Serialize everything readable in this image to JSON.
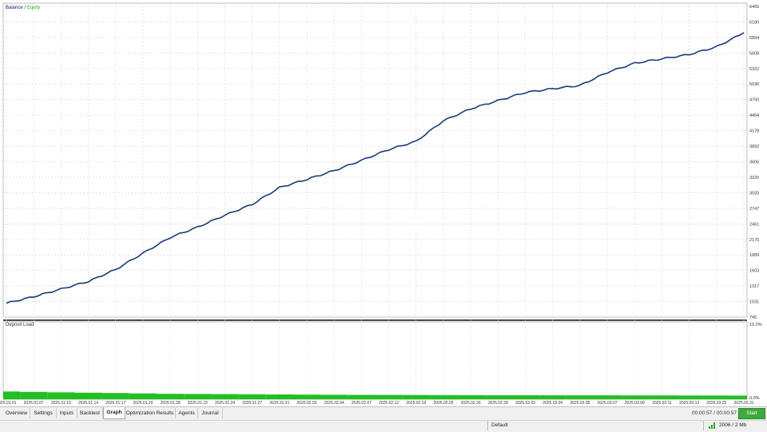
{
  "chart": {
    "legend_balance": "Balance",
    "legend_separator": " / ",
    "legend_equity": "Equity",
    "subchart_title": "Deposit Load",
    "line_color": "#1a3a7a",
    "load_color": "#21c021",
    "y_ticks": [
      "6466",
      "6180",
      "5894",
      "5608",
      "5322",
      "5036",
      "4750",
      "4464",
      "4178",
      "3892",
      "3606",
      "3320",
      "3033",
      "2747",
      "2461",
      "2175",
      "1889",
      "1603",
      "1317",
      "1031",
      "745"
    ],
    "load_ticks": [
      "10.0%",
      "0.0%"
    ],
    "x_ticks": [
      "2025.01.01",
      "2025.01.07",
      "2025.01.10",
      "2025.01.14",
      "2025.01.17",
      "2025.01.20",
      "2025.01.28",
      "2025.01.23",
      "2025.01.24",
      "2025.01.27",
      "2025.01.31",
      "2025.02.03",
      "2025.02.04",
      "2025.02.07",
      "2025.02.12",
      "2025.02.19",
      "2025.02.25",
      "2025.02.26",
      "2025.02.28",
      "2025.03.03",
      "2025.03.04",
      "2025.03.05",
      "2025.03.07",
      "2025.03.09",
      "2025.03.11",
      "2025.03.13",
      "2025.03.25",
      "2025.03.31"
    ]
  },
  "chart_data": {
    "type": "line",
    "title": "",
    "series": [
      {
        "name": "Balance",
        "x": [
          "2025.01.01",
          "2025.01.07",
          "2025.01.10",
          "2025.01.14",
          "2025.01.17",
          "2025.01.20",
          "2025.01.28",
          "2025.01.23",
          "2025.01.24",
          "2025.01.27",
          "2025.01.31",
          "2025.02.03",
          "2025.02.04",
          "2025.02.07",
          "2025.02.12",
          "2025.02.19",
          "2025.02.25",
          "2025.02.26",
          "2025.02.28",
          "2025.03.03",
          "2025.03.04",
          "2025.03.05",
          "2025.03.07",
          "2025.03.09",
          "2025.03.11",
          "2025.03.13",
          "2025.03.25",
          "2025.03.31"
        ],
        "values": [
          1000,
          1120,
          1260,
          1400,
          1620,
          1920,
          2210,
          2400,
          2620,
          2820,
          3130,
          3280,
          3440,
          3630,
          3830,
          3980,
          4360,
          4580,
          4730,
          4880,
          4950,
          5010,
          5250,
          5420,
          5500,
          5580,
          5720,
          5980
        ]
      },
      {
        "name": "Deposit Load",
        "values": [
          1.0,
          0.95,
          0.9,
          0.85,
          0.8,
          0.75,
          0.7,
          0.68,
          0.66,
          0.64,
          0.62,
          0.6,
          0.58,
          0.57,
          0.56,
          0.55,
          0.54,
          0.53,
          0.52,
          0.52,
          0.51,
          0.5,
          0.5,
          0.49,
          0.49,
          0.48,
          0.48,
          0.47
        ]
      }
    ],
    "ylim": [
      745,
      6466
    ],
    "load_ylim": [
      0,
      10
    ],
    "grid": true
  },
  "tabs": [
    {
      "label": "Overview"
    },
    {
      "label": "Settings"
    },
    {
      "label": "Inputs"
    },
    {
      "label": "Backtest"
    },
    {
      "label": "Graph"
    },
    {
      "label": "Optimization Results"
    },
    {
      "label": "Agents"
    },
    {
      "label": "Journal"
    }
  ],
  "toolbar": {
    "timer": "00:00:57 / 00:00:57",
    "start_label": "Start"
  },
  "status": {
    "profile": "Default",
    "connection": "2006 / 2 Mb"
  }
}
